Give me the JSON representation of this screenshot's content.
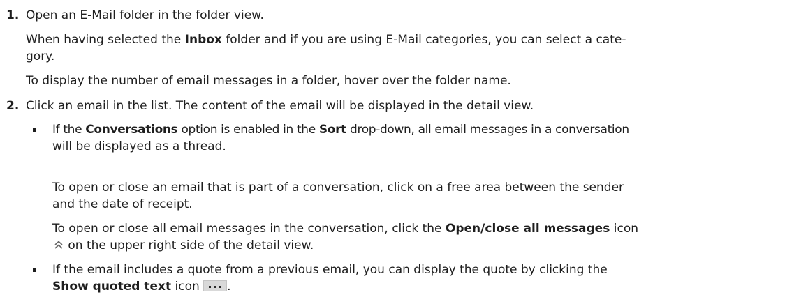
{
  "steps": [
    {
      "num": "1.",
      "l1": "Open an E-Mail folder in the folder view.",
      "l2a": "When having selected the ",
      "l2b": "Inbox",
      "l2c": " folder and if you are using E-Mail categories, you can select a cate-",
      "l3": "gory.",
      "l4": "To display the number of email messages in a folder, hover over the folder name."
    },
    {
      "num": "2.",
      "l1": "Click an email in the list. The content of the email will be displayed in the detail view."
    }
  ],
  "bullets": [
    {
      "a1": "If the ",
      "b1": "Conversations",
      "a2": " option is enabled in the ",
      "b2": "Sort",
      "a3": " drop-down, all email messages in a conversation",
      "l2": "will be displayed as a thread.",
      "l3": "To open or close an email that is part of a conversation, click on a free area between the sender",
      "l4": "and the date of receipt.",
      "l5a": "To open or close all email messages in the conversation, click the ",
      "l5b": "Open/close all messages",
      "l5c": " icon",
      "l6": " on the upper right side of the detail view.",
      "icon": "double-chevron-up-icon"
    },
    {
      "l1": "If the email includes a quote from a previous email, you can display the quote by clicking the",
      "l2b": "Show quoted text",
      "l2c": " icon ",
      "l2end": ".",
      "icon": "ellipsis-icon"
    }
  ]
}
